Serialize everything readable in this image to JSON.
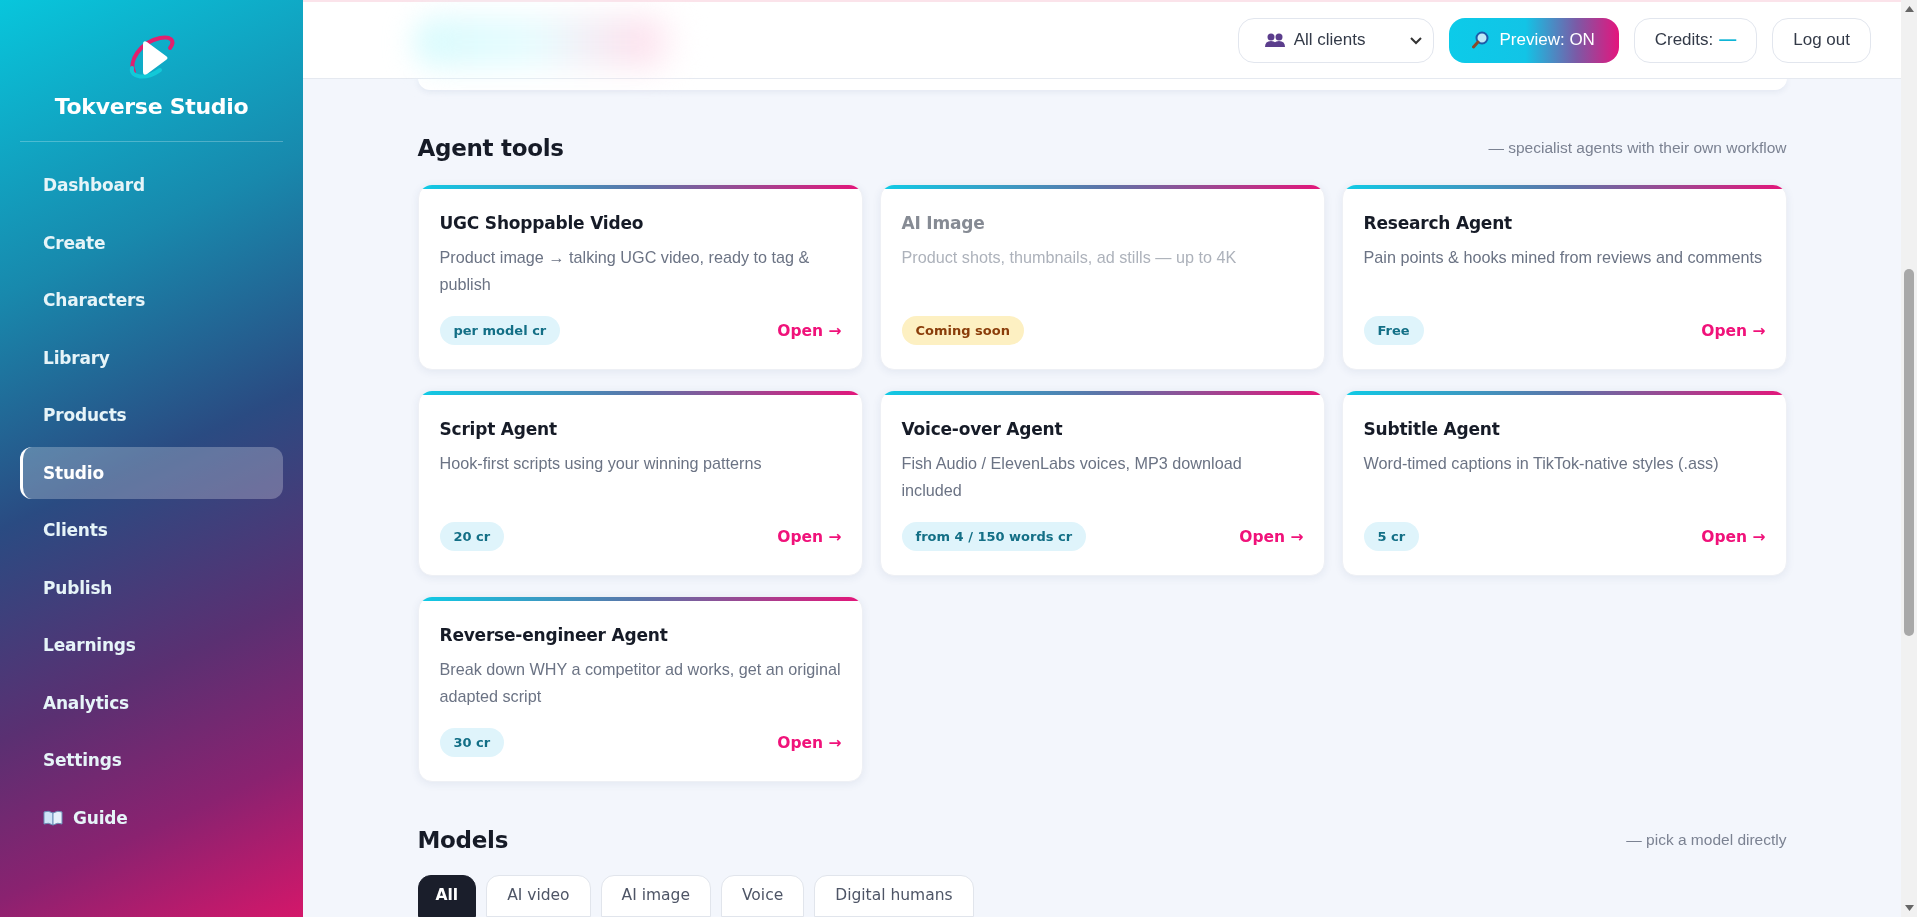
{
  "brand": {
    "name": "Tokverse Studio"
  },
  "nav": [
    {
      "label": "Dashboard",
      "kind": "link",
      "selected": false
    },
    {
      "label": "Create",
      "kind": "link",
      "selected": false
    },
    {
      "label": "Characters",
      "kind": "link",
      "selected": false
    },
    {
      "label": "Library",
      "kind": "link",
      "selected": false
    },
    {
      "label": "Products",
      "kind": "link",
      "selected": false
    },
    {
      "label": "Studio",
      "kind": "link",
      "selected": true
    },
    {
      "label": "Clients",
      "kind": "link",
      "selected": false
    },
    {
      "label": "Publish",
      "kind": "link",
      "selected": false
    },
    {
      "label": "Learnings",
      "kind": "link",
      "selected": false
    },
    {
      "label": "Analytics",
      "kind": "link",
      "selected": false
    },
    {
      "label": "Settings",
      "kind": "link",
      "selected": false
    },
    {
      "label": "Guide",
      "kind": "guide",
      "selected": false
    }
  ],
  "topbar": {
    "client_filter": {
      "value": "All clients"
    },
    "preview": {
      "label": "Preview: ON"
    },
    "credits": {
      "label": "Credits:",
      "value": "—"
    },
    "logout": "Log out"
  },
  "agent_tools": {
    "title": "Agent tools",
    "subtitle": "— specialist agents with their own workflow",
    "cards": [
      {
        "title": "UGC Shoppable Video",
        "description": "Product image → talking UGC video, ready to tag & publish",
        "chip": {
          "kind": "price",
          "text": "per model cr"
        },
        "action": "Open →",
        "disabled": false
      },
      {
        "title": "AI Image",
        "description": "Product shots, thumbnails, ad stills — up to 4K",
        "chip": {
          "kind": "status",
          "text": "Coming soon"
        },
        "disabled": true
      },
      {
        "title": "Research Agent",
        "description": "Pain points & hooks mined from reviews and comments",
        "chip": {
          "kind": "price",
          "text": "Free"
        },
        "action": "Open →",
        "disabled": false
      },
      {
        "title": "Script Agent",
        "description": "Hook-first scripts using your winning patterns",
        "chip": {
          "kind": "price",
          "text": "20 cr"
        },
        "action": "Open →",
        "disabled": false
      },
      {
        "title": "Voice-over Agent",
        "description": "Fish Audio / ElevenLabs voices, MP3 download included",
        "chip": {
          "kind": "price",
          "text": "from 4 / 150 words cr"
        },
        "action": "Open →",
        "disabled": false
      },
      {
        "title": "Subtitle Agent",
        "description": "Word-timed captions in TikTok-native styles (.ass)",
        "chip": {
          "kind": "price",
          "text": "5 cr"
        },
        "action": "Open →",
        "disabled": false
      },
      {
        "title": "Reverse-engineer Agent",
        "description": "Break down WHY a competitor ad works, get an original adapted script",
        "chip": {
          "kind": "price",
          "text": "30 cr"
        },
        "action": "Open →",
        "disabled": false
      }
    ]
  },
  "models": {
    "title": "Models",
    "subtitle": "— pick a model directly",
    "filters": [
      {
        "label": "All",
        "selected": true
      },
      {
        "label": "AI video",
        "selected": false
      },
      {
        "label": "AI image",
        "selected": false
      },
      {
        "label": "Voice",
        "selected": false
      },
      {
        "label": "Digital humans",
        "selected": false
      }
    ]
  }
}
